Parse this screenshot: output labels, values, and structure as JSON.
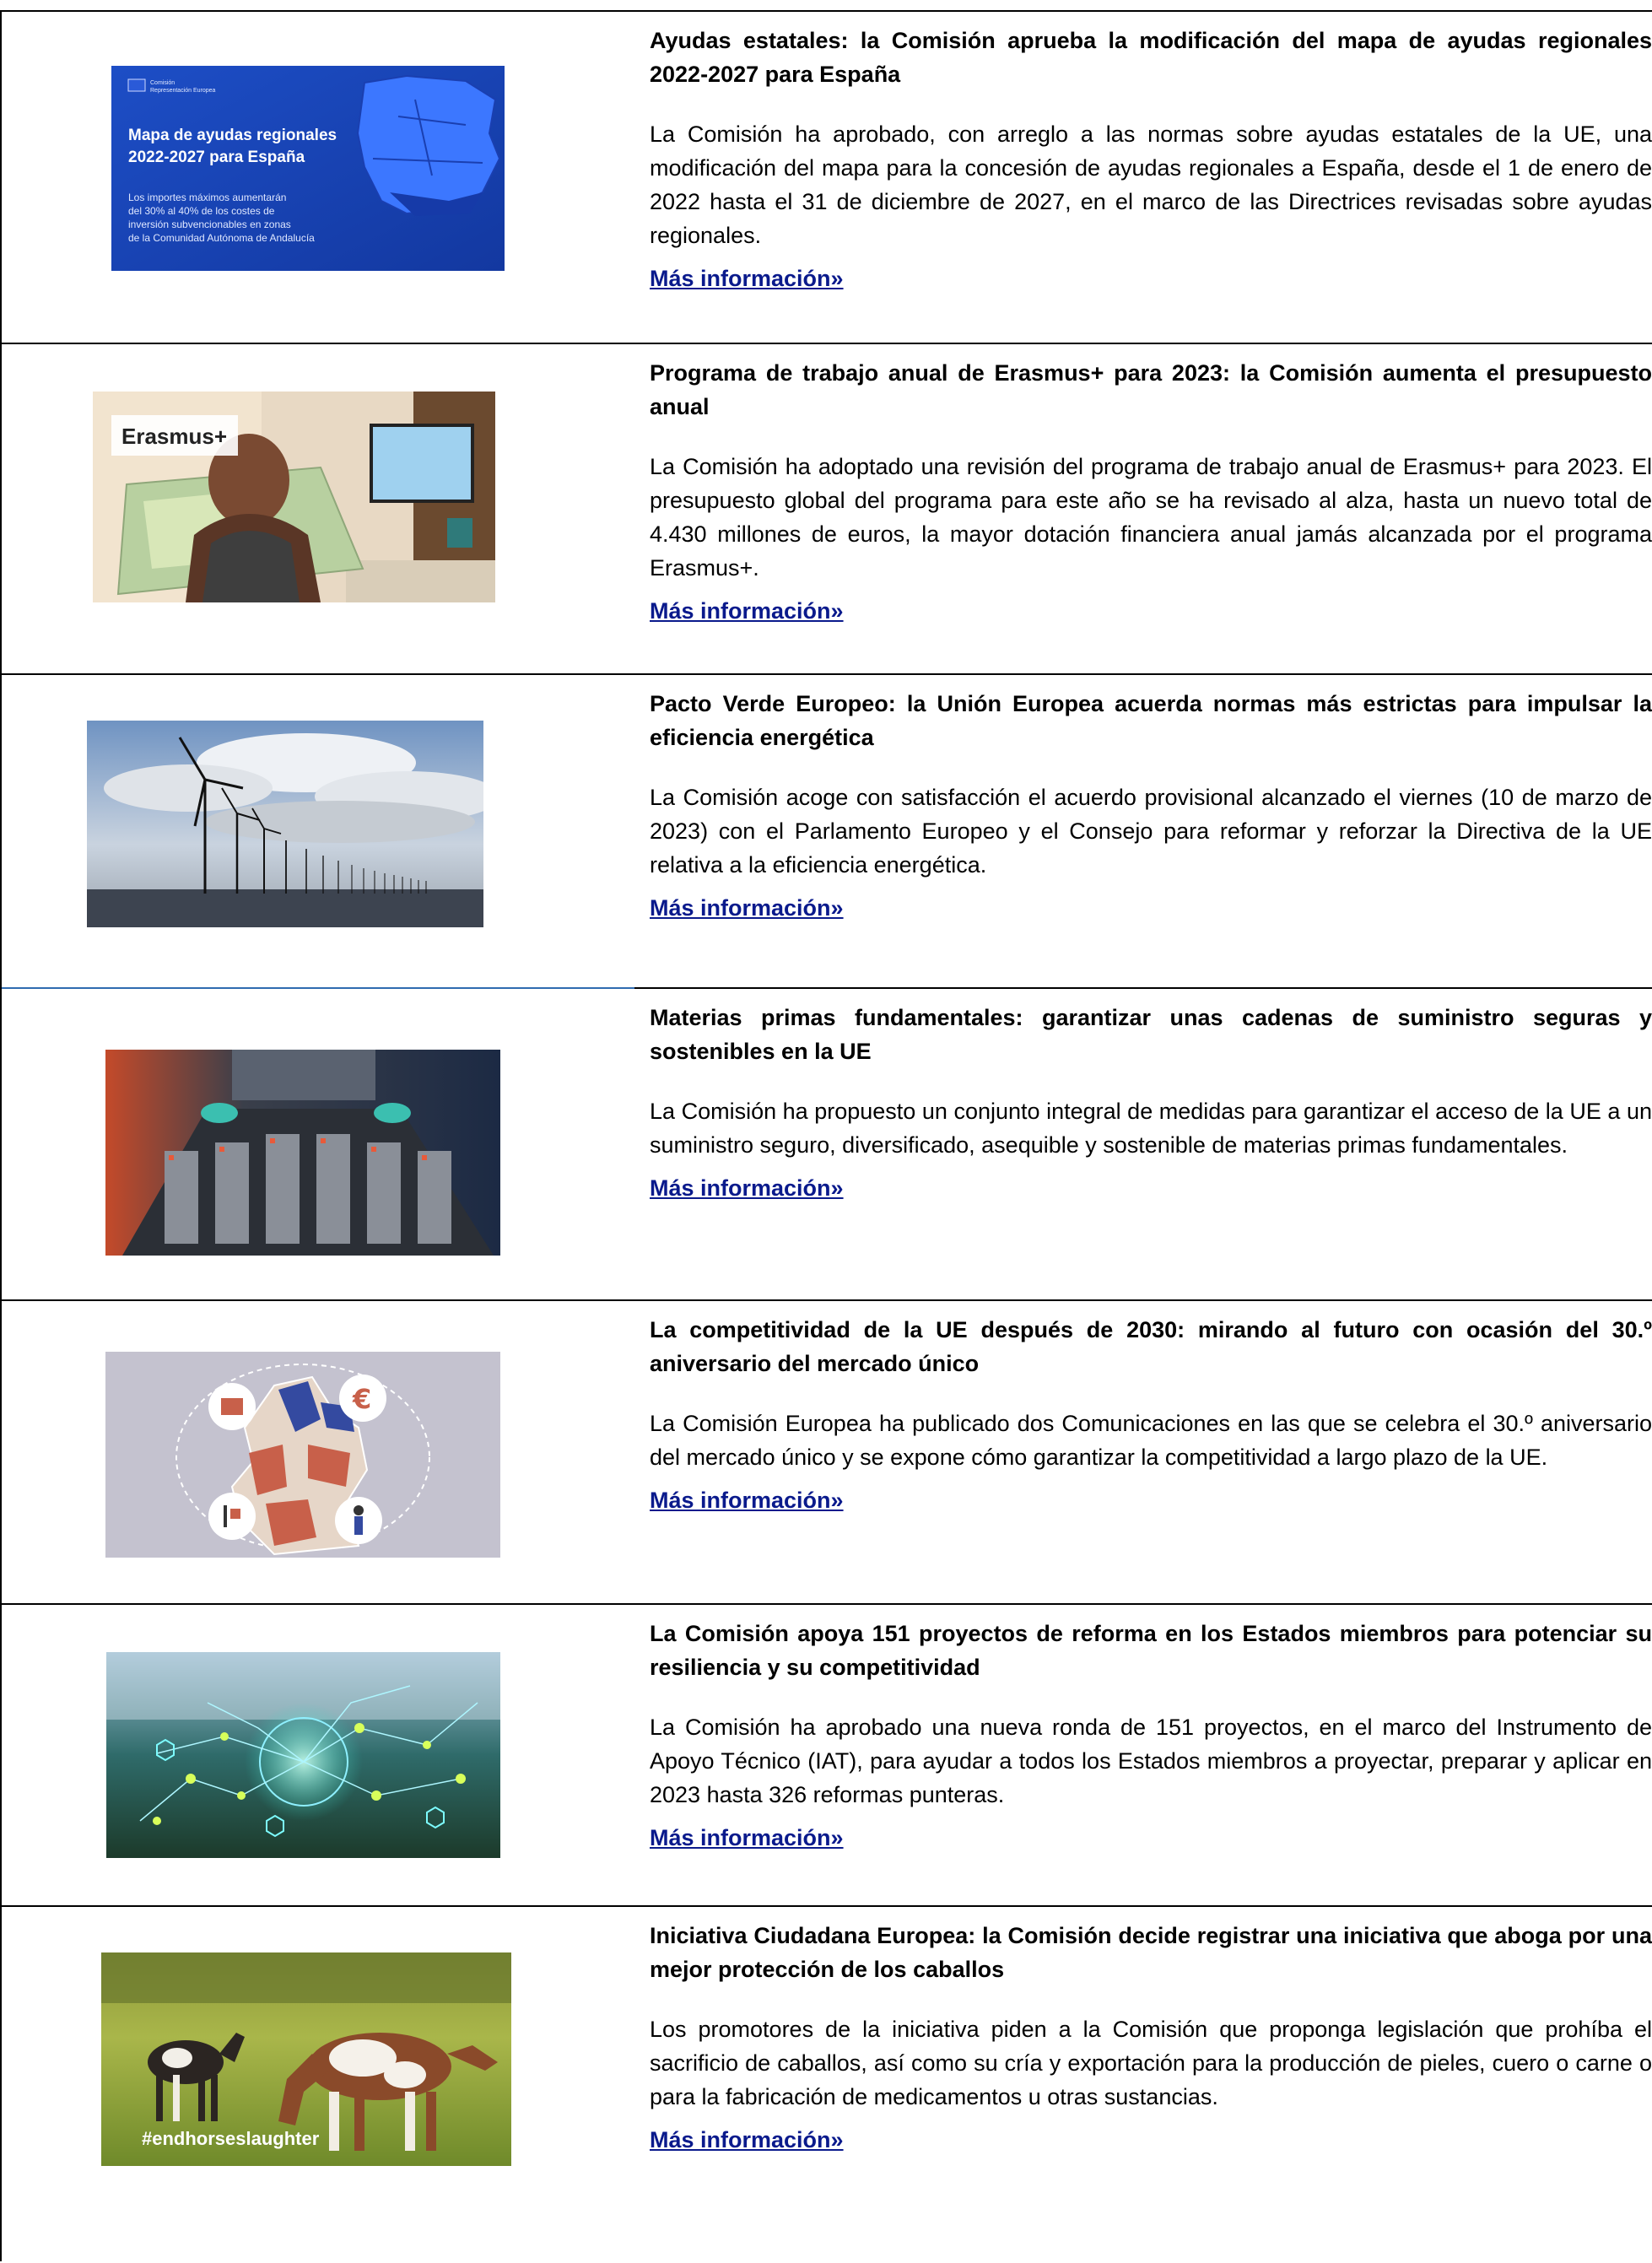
{
  "articles": [
    {
      "title": "Ayudas estatales: la Comisión aprueba la modificación del mapa de ayudas regionales 2022-2027 para España",
      "body": "La Comisión ha aprobado, con arreglo a las normas sobre ayudas estatales de la UE, una modificación del mapa para la concesión de ayudas regionales a España, desde el 1 de enero de 2022 hasta el 31 de diciembre de 2027, en el marco de las Directrices revisadas sobre ayudas regionales.",
      "link": "Más información»",
      "image": {
        "org_line1": "Comisión",
        "org_line2": "Representación Europea",
        "heading_line1": "Mapa de ayudas regionales",
        "heading_line2": "2022-2027 para España",
        "caption_line1": "Los importes máximos aumentarán",
        "caption_line2": "del 30% al 40% de los costes de",
        "caption_line3": "inversión subvencionables en zonas",
        "caption_line4": "de la Comunidad Autónoma de Andalucía"
      }
    },
    {
      "title": "Programa de trabajo anual de Erasmus+ para 2023: la Comisión aumenta el presupuesto anual",
      "body": "La Comisión ha adoptado una revisión del programa de trabajo anual de Erasmus+ para 2023. El presupuesto global del programa para este año se ha revisado al alza, hasta un nuevo total de 4.430 millones de euros, la mayor dotación financiera anual jamás alcanzada por el programa Erasmus+.",
      "link": "Más información»",
      "image": {
        "label": "Erasmus+"
      }
    },
    {
      "title": "Pacto Verde Europeo: la Unión Europea acuerda normas más estrictas para impulsar la eficiencia energética",
      "body": "La Comisión acoge con satisfacción el acuerdo provisional alcanzado el viernes (10 de marzo de 2023) con el Parlamento Europeo y el Consejo para reformar y reforzar la Directiva de la UE relativa a la eficiencia energética.",
      "link": "Más información»"
    },
    {
      "title": "Materias primas fundamentales: garantizar unas cadenas de suministro seguras y sostenibles en la UE",
      "body": "La Comisión ha propuesto un conjunto integral de medidas para garantizar el acceso de la UE a un suministro seguro, diversificado, asequible y sostenible de materias primas fundamentales.",
      "link": "Más información»"
    },
    {
      "title": "La competitividad de la UE después de 2030: mirando al futuro con ocasión del 30.º aniversario del mercado único",
      "body": "La Comisión Europea ha publicado dos Comunicaciones en las que se celebra el 30.º aniversario del mercado único y se expone cómo garantizar la competitividad a largo plazo de la UE.",
      "link": "Más información»",
      "image": {
        "symbol": "€"
      }
    },
    {
      "title": "La Comisión apoya 151 proyectos de reforma en los Estados miembros para potenciar su resiliencia y su competitividad",
      "body": "La Comisión ha aprobado una nueva ronda de 151 proyectos, en el marco del Instrumento de Apoyo Técnico (IAT), para ayudar a todos los Estados miembros a proyectar, preparar y aplicar en 2023 hasta 326 reformas punteras.",
      "link": "Más información»"
    },
    {
      "title": "Iniciativa Ciudadana Europea: la Comisión decide registrar una iniciativa que aboga por una mejor protección de los caballos",
      "body": "Los promotores de la iniciativa piden a la Comisión que proponga legislación que prohíba el sacrificio de caballos, así como su cría y exportación para la producción de pieles, cuero o carne o para la fabricación de medicamentos u otras sustancias.",
      "link": "Más información»",
      "image": {
        "hashtag": "#endhorseslaughter"
      }
    }
  ],
  "colors": {
    "link": "#0a1a8c",
    "map_blue": "#1b4fc4",
    "divider_blue": "#2f6bb0"
  }
}
